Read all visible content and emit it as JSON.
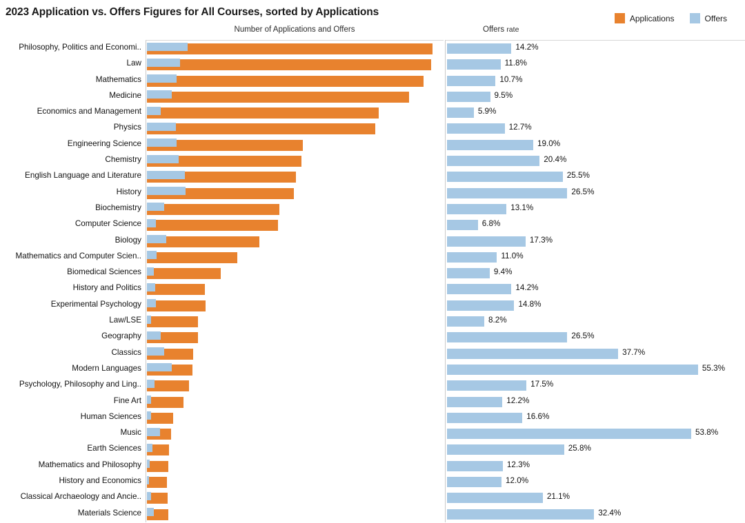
{
  "header": {
    "title": "2023 Application vs. Offers Figures for All Courses, sorted by Applications",
    "left_axis_title": "Number of Applications and Offers",
    "right_axis_title_main": "Offers",
    "right_axis_title_sub": "rate"
  },
  "legend": {
    "position": "top-right",
    "items": [
      {
        "label": "Applications",
        "color": "#E8822E",
        "icon": "square-swatch"
      },
      {
        "label": "Offers",
        "color": "#A6C8E4",
        "icon": "square-swatch"
      }
    ]
  },
  "colors": {
    "applications": "#E8822E",
    "offers": "#A6C8E4",
    "axis": "#c9c9c9",
    "text": "#111111",
    "background": "#ffffff"
  },
  "chart_data": {
    "type": "bar",
    "orientation": "horizontal",
    "title": "2023 Application vs. Offers Figures for All Courses, sorted by Applications",
    "panels": [
      {
        "name": "applications-and-offers",
        "xlabel": "Number of Applications and Offers",
        "grid": false,
        "xlim": [
          0,
          1000
        ],
        "series": [
          {
            "name": "Applications",
            "color": "#E8822E"
          },
          {
            "name": "Offers",
            "color": "#A6C8E4"
          }
        ]
      },
      {
        "name": "offers-rate",
        "xlabel": "Offers rate",
        "grid": false,
        "xlim": [
          0,
          60
        ],
        "unit": "%",
        "series": [
          {
            "name": "Offers rate",
            "color": "#A6C8E4"
          }
        ]
      }
    ],
    "categories": [
      "Philosophy, Politics and Economi..",
      "Law",
      "Mathematics",
      "Medicine",
      "Economics and Management",
      "Physics",
      "Engineering Science",
      "Chemistry",
      "English Language and Literature",
      "History",
      "Biochemistry",
      "Computer Science",
      "Biology",
      "Mathematics and Computer Scien..",
      "Biomedical Sciences",
      "History and Politics",
      "Experimental Psychology",
      "Law/LSE",
      "Geography",
      "Classics",
      "Modern Languages",
      "Psychology, Philosophy and Ling..",
      "Fine Art",
      "Human Sciences",
      "Music",
      "Earth Sciences",
      "Mathematics and Philosophy",
      "History and Economics",
      "Classical Archaeology and Ancie..",
      "Materials Science"
    ],
    "applications": [
      958,
      953,
      928,
      880,
      778,
      766,
      523,
      518,
      500,
      492,
      444,
      440,
      378,
      304,
      248,
      194,
      196,
      172,
      172,
      156,
      152,
      140,
      122,
      88,
      80,
      74,
      72,
      68,
      70,
      72
    ],
    "offers": [
      136,
      112,
      99,
      84,
      46,
      97,
      99,
      106,
      128,
      130,
      58,
      30,
      65,
      33,
      23,
      28,
      29,
      14,
      46,
      59,
      84,
      25,
      15,
      15,
      43,
      19,
      9,
      8,
      15,
      23
    ],
    "offers_rate": [
      14.2,
      11.8,
      10.7,
      9.5,
      5.9,
      12.7,
      19.0,
      20.4,
      25.5,
      26.5,
      13.1,
      6.8,
      17.3,
      11.0,
      9.4,
      14.2,
      14.8,
      8.2,
      26.5,
      37.7,
      55.3,
      17.5,
      12.2,
      16.6,
      53.8,
      25.8,
      12.3,
      12.0,
      21.1,
      32.4
    ],
    "offers_rate_labels": [
      "14.2%",
      "11.8%",
      "10.7%",
      "9.5%",
      "5.9%",
      "12.7%",
      "19.0%",
      "20.4%",
      "25.5%",
      "26.5%",
      "13.1%",
      "6.8%",
      "17.3%",
      "11.0%",
      "9.4%",
      "14.2%",
      "14.8%",
      "8.2%",
      "26.5%",
      "37.7%",
      "55.3%",
      "17.5%",
      "12.2%",
      "16.6%",
      "53.8%",
      "25.8%",
      "12.3%",
      "12.0%",
      "21.1%",
      "32.4%"
    ]
  }
}
